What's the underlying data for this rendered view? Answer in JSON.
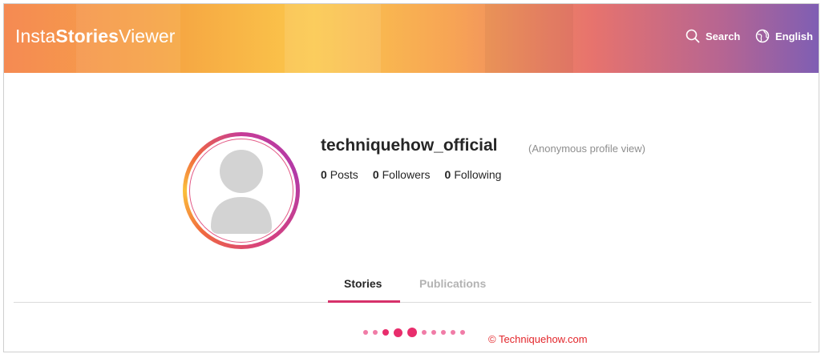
{
  "header": {
    "logo": {
      "part1": "Insta",
      "part2": "Stories",
      "part3": "Viewer"
    },
    "search_label": "Search",
    "language_label": "English"
  },
  "profile": {
    "username": "techniquehow_official",
    "view_mode": "(Anonymous profile view)",
    "stats": [
      {
        "value": "0",
        "label": "Posts"
      },
      {
        "value": "0",
        "label": "Followers"
      },
      {
        "value": "0",
        "label": "Following"
      }
    ]
  },
  "tabs": [
    {
      "label": "Stories",
      "active": true
    },
    {
      "label": "Publications",
      "active": false
    }
  ],
  "watermark": "© Techniquehow.com",
  "colors": {
    "accent": "#d6316a",
    "loader_dot": "#f07ca7",
    "watermark": "#e3262b",
    "header_gradient": [
      "#f58a53",
      "#fbc84b",
      "#e7736d",
      "#7e5eb4"
    ]
  },
  "icons": {
    "search": "search-icon",
    "language": "globe-icon",
    "avatar": "default-avatar-icon"
  }
}
